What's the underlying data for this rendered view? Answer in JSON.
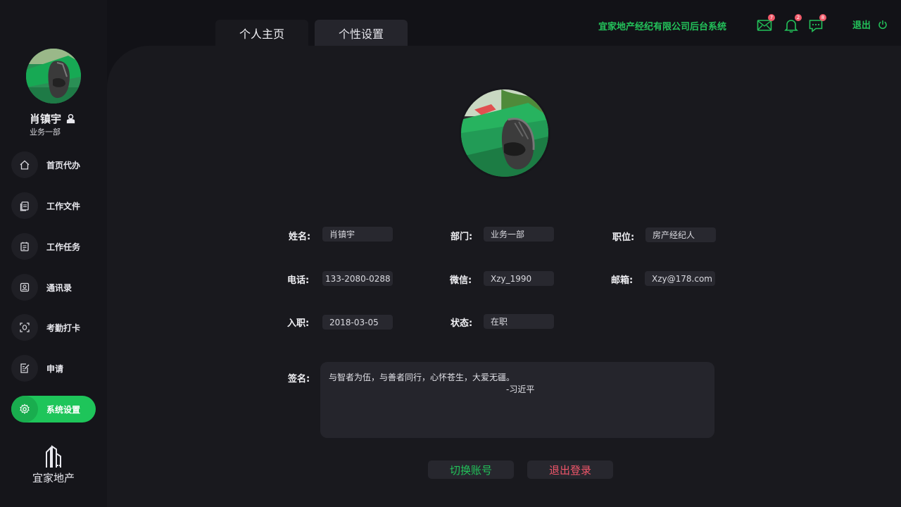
{
  "app": {
    "company_title": "宜家地产经纪有限公司后台系统",
    "brand_name": "宜家地产",
    "accent_color": "#23c25a",
    "danger_color": "#f0566a"
  },
  "user": {
    "name": "肖镇宇",
    "department": "业务一部"
  },
  "tabs": [
    {
      "label": "个人主页",
      "active": true
    },
    {
      "label": "个性设置",
      "active": false
    }
  ],
  "topbar": {
    "mail_badge": "7",
    "bell_badge": "2",
    "chat_badge": "8",
    "logout_label": "退出"
  },
  "sidebar": {
    "items": [
      {
        "label": "首页代办",
        "icon": "home-icon",
        "active": false
      },
      {
        "label": "工作文件",
        "icon": "files-icon",
        "active": false
      },
      {
        "label": "工作任务",
        "icon": "task-icon",
        "active": false
      },
      {
        "label": "通讯录",
        "icon": "contacts-icon",
        "active": false
      },
      {
        "label": "考勤打卡",
        "icon": "face-scan-icon",
        "active": false
      },
      {
        "label": "申请",
        "icon": "edit-doc-icon",
        "active": false
      },
      {
        "label": "系统设置",
        "icon": "gear-icon",
        "active": true
      }
    ]
  },
  "profile": {
    "name_label": "姓名:",
    "name_value": "肖镇宇",
    "dept_label": "部门:",
    "dept_value": "业务一部",
    "position_label": "职位:",
    "position_value": "房产经纪人",
    "phone_label": "电话:",
    "phone_value": "133-2080-0288",
    "wechat_label": "微信:",
    "wechat_value": "Xzy_1990",
    "email_label": "邮箱:",
    "email_value": "Xzy@178.com",
    "join_label": "入职:",
    "join_value": "2018-03-05",
    "status_label": "状态:",
    "status_value": "在职",
    "signature_label": "签名:",
    "signature_text": "与智者为伍，与善者同行，心怀苍生，大爱无疆。",
    "signature_author": "-习近平"
  },
  "actions": {
    "switch_account": "切换账号",
    "logout": "退出登录"
  }
}
